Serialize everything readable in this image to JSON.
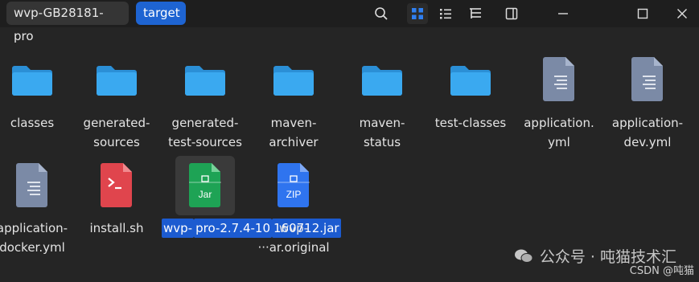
{
  "breadcrumb": {
    "parent": "wvp-GB28181-pro",
    "current": "target"
  },
  "toolbar": {
    "icons": [
      "search-icon",
      "grid-view-icon",
      "list-view-icon",
      "tree-view-icon",
      "preview-pane-icon",
      "minimize-icon",
      "maximize-icon",
      "close-icon"
    ],
    "active": "grid-view-icon"
  },
  "items": [
    {
      "type": "folder",
      "name": [
        "classes"
      ]
    },
    {
      "type": "folder",
      "name": [
        "generated-",
        "sources"
      ]
    },
    {
      "type": "folder",
      "name": [
        "generated-",
        "test-sources"
      ]
    },
    {
      "type": "folder",
      "name": [
        "maven-",
        "archiver"
      ]
    },
    {
      "type": "folder",
      "name": [
        "maven-",
        "status"
      ]
    },
    {
      "type": "folder",
      "name": [
        "test-classes"
      ]
    },
    {
      "type": "document",
      "name": [
        "application.",
        "yml"
      ]
    },
    {
      "type": "document",
      "name": [
        "application-",
        "dev.yml"
      ]
    },
    {
      "type": "document",
      "name": [
        "application-",
        "docker.yml"
      ]
    },
    {
      "type": "script",
      "name": [
        "install.sh"
      ]
    },
    {
      "type": "jar",
      "badge": "Jar",
      "selected": true,
      "name": [
        "wvp-",
        "pro-2.7.4-10",
        "160712.jar"
      ]
    },
    {
      "type": "zip",
      "badge": "ZIP",
      "name": [
        "wvp-",
        "···ar.original"
      ]
    }
  ],
  "watermark": {
    "text": "公众号 · 吨猫技术汇",
    "csdn": "CSDN @吨猫"
  },
  "colors": {
    "folder": "#3aa9f0",
    "accent": "#1e64d2",
    "doc": "#7b8aa6",
    "script": "#e0454d",
    "jar": "#1ea355",
    "zip": "#2f74ef"
  }
}
